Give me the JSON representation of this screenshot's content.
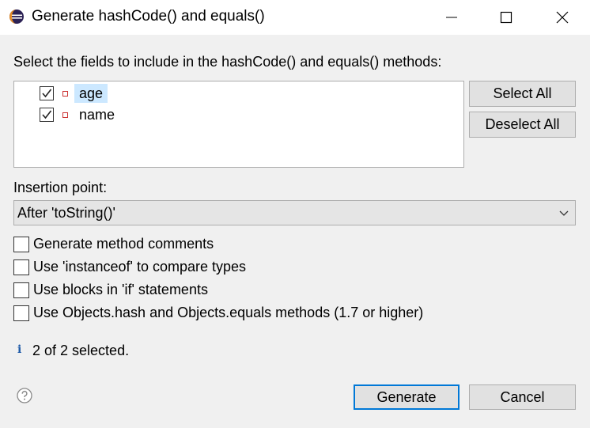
{
  "window": {
    "title": "Generate hashCode() and equals()",
    "icon": "eclipse-icon",
    "controls": [
      "minimize-icon",
      "maximize-icon",
      "close-icon"
    ]
  },
  "prompt": "Select the fields to include in the hashCode() and equals() methods:",
  "fields": [
    {
      "label": "age",
      "checked": true,
      "selected": true,
      "icon": "field-private-icon"
    },
    {
      "label": "name",
      "checked": true,
      "selected": false,
      "icon": "field-private-icon"
    }
  ],
  "buttons": {
    "select_all": "Select All",
    "deselect_all": "Deselect All",
    "generate": "Generate",
    "cancel": "Cancel"
  },
  "insertion": {
    "label": "Insertion point:",
    "value": "After 'toString()'"
  },
  "options": [
    {
      "label": "Generate method comments",
      "checked": false
    },
    {
      "label": "Use 'instanceof' to compare types",
      "checked": false
    },
    {
      "label": "Use blocks in 'if' statements",
      "checked": false
    },
    {
      "label": "Use Objects.hash and Objects.equals methods (1.7 or higher)",
      "checked": false
    }
  ],
  "status": {
    "icon": "info-icon",
    "glyph": "i",
    "text": "2 of 2 selected."
  },
  "help": {
    "icon": "help-icon"
  },
  "colors": {
    "dialog_bg": "#f0f0f0",
    "selection": "#cce8ff",
    "default_button_border": "#0078d7",
    "field_icon": "#cc3333"
  }
}
